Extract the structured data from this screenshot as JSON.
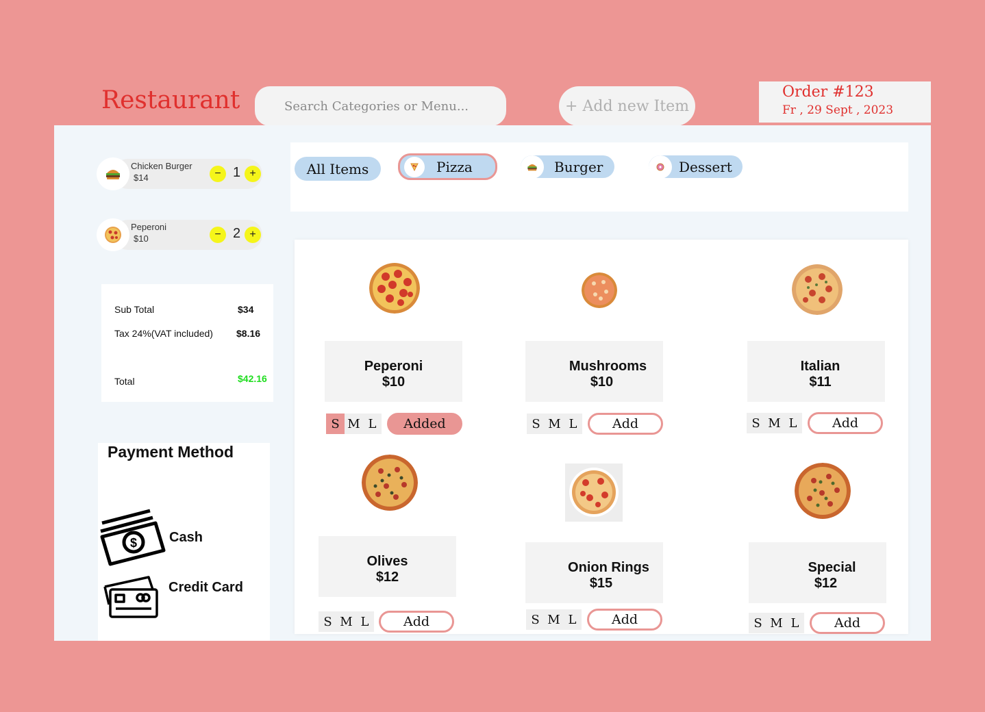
{
  "header": {
    "brand": "Restaurant",
    "search_placeholder": "Search Categories or Menu...",
    "add_new_item": "+ Add new Item",
    "order_number": "Order #123",
    "order_date": "Fr , 29 Sept , 2023"
  },
  "cart": {
    "items": [
      {
        "name": "Chicken Burger",
        "price": "$14",
        "qty": "1",
        "icon": "burger-icon"
      },
      {
        "name": "Peperoni",
        "price": "$10",
        "qty": "2",
        "icon": "pizza-icon"
      }
    ],
    "minus": "−",
    "plus": "+"
  },
  "totals": {
    "subtotal_label": "Sub Total",
    "subtotal_value": "$34",
    "tax_label": "Tax 24%(VAT included)",
    "tax_value": "$8.16",
    "total_label": "Total",
    "total_value": "$42.16",
    "total_color": "#1FDD1F"
  },
  "payment": {
    "title": "Payment Method",
    "options": [
      "Cash",
      "Credit Card"
    ]
  },
  "categories": [
    {
      "label": "All Items"
    },
    {
      "label": "Pizza",
      "selected": true,
      "icon": "pizza-slice-icon"
    },
    {
      "label": "Burger",
      "icon": "burger-icon"
    },
    {
      "label": "Dessert",
      "icon": "donut-icon"
    }
  ],
  "menu": {
    "sizes": [
      "S",
      "M",
      "L"
    ],
    "items": [
      {
        "name": "Peperoni",
        "price": "$10",
        "button": "Added",
        "added": true,
        "selected_size": "S"
      },
      {
        "name": "Mushrooms",
        "price": "$10",
        "button": "Add"
      },
      {
        "name": "Italian",
        "price": "$11",
        "button": "Add"
      },
      {
        "name": "Olives",
        "price": "$12",
        "button": "Add"
      },
      {
        "name": "Onion Rings",
        "price": "$15",
        "button": "Add"
      },
      {
        "name": "Special",
        "price": "$12",
        "button": "Add"
      }
    ]
  },
  "colors": {
    "background": "#ED9694",
    "brand": "#E0302E",
    "accent": "#E99694",
    "chip": "#BFD9F0",
    "qty_button": "#F5F51A"
  }
}
